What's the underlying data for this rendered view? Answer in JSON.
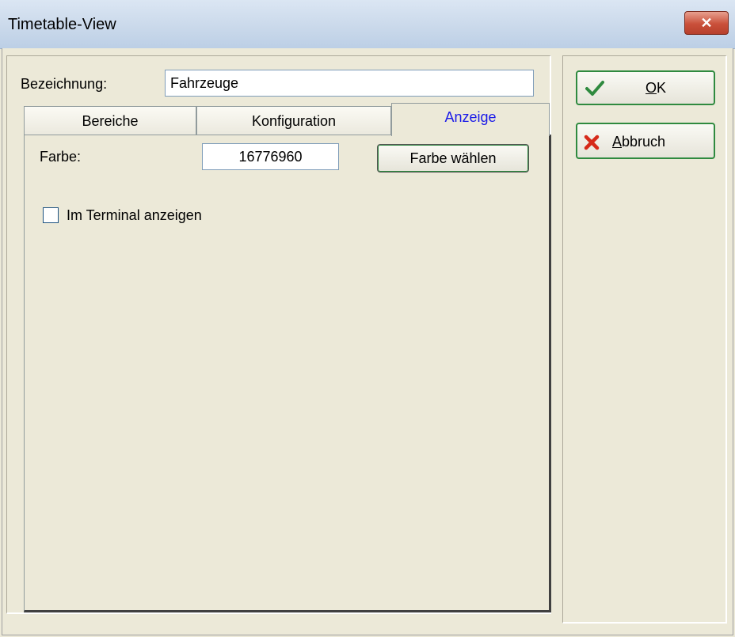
{
  "window": {
    "title": "Timetable-View",
    "close_glyph": "✕"
  },
  "form": {
    "name_label": "Bezeichnung:",
    "name_value": "Fahrzeuge"
  },
  "tabs": [
    {
      "label": "Bereiche",
      "active": false
    },
    {
      "label": "Konfiguration",
      "active": false
    },
    {
      "label": "Anzeige",
      "active": true
    }
  ],
  "anzeige": {
    "color_label": "Farbe:",
    "color_value": "16776960",
    "choose_color_label": "Farbe wählen",
    "terminal_checkbox_label": "Im Terminal anzeigen",
    "terminal_checked": false
  },
  "buttons": {
    "ok_mnemonic": "O",
    "ok_rest": "K",
    "cancel_mnemonic": "A",
    "cancel_rest": "bbruch"
  },
  "icons": {
    "ok": "checkmark-icon",
    "cancel": "red-x-icon"
  },
  "colors": {
    "active_tab_text": "#1a1ae8",
    "button_border": "#2f8a3f",
    "cancel_icon": "#d62a1a",
    "ok_icon": "#2f8a3f"
  }
}
